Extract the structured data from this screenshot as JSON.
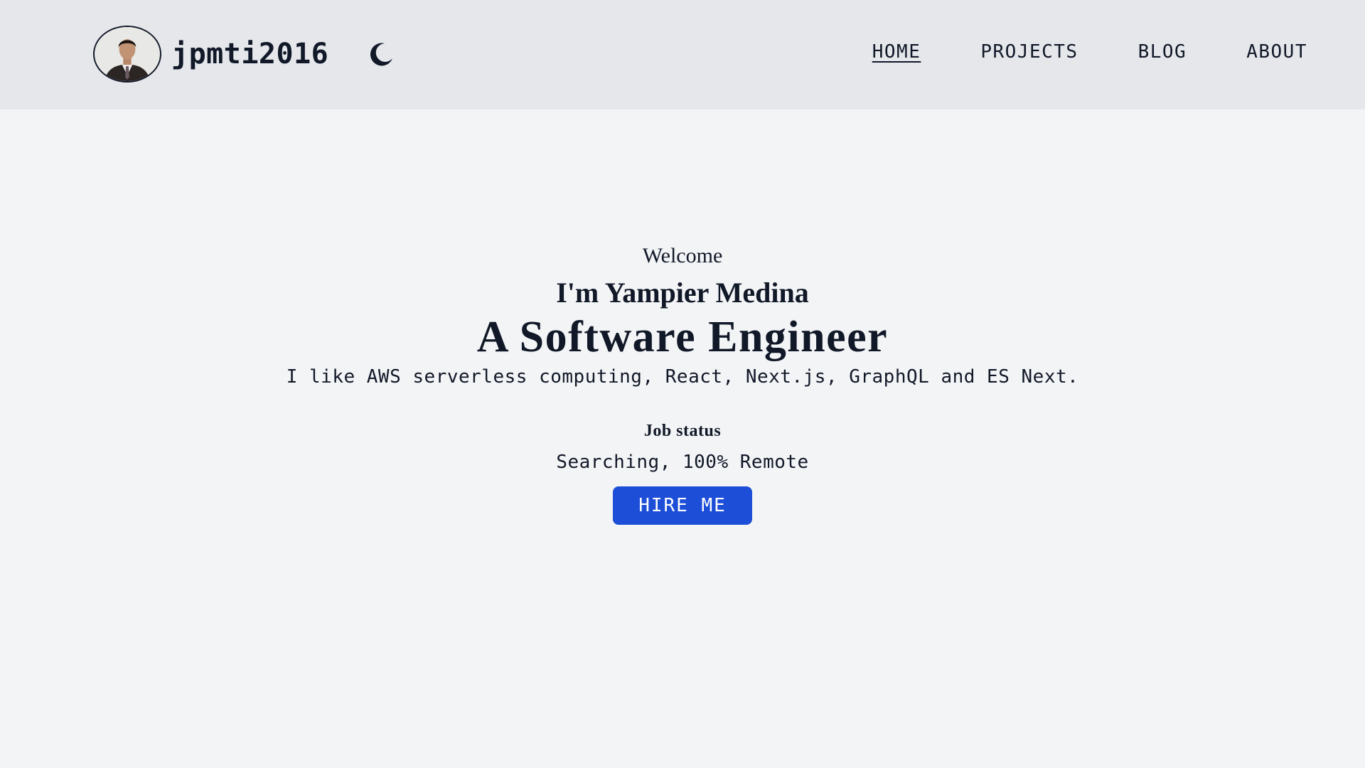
{
  "header": {
    "site_name": "jpmti2016",
    "avatar_icon": "avatar-photo",
    "theme_toggle_icon": "moon-icon",
    "nav": [
      {
        "label": "HOME",
        "active": true
      },
      {
        "label": "PROJECTS",
        "active": false
      },
      {
        "label": "BLOG",
        "active": false
      },
      {
        "label": "ABOUT",
        "active": false
      }
    ]
  },
  "hero": {
    "welcome": "Welcome",
    "intro": "I'm Yampier Medina",
    "role": "A Software Engineer",
    "tagline": "I like AWS serverless computing, React, Next.js, GraphQL and ES Next.",
    "job_status_heading": "Job status",
    "job_status_value": "Searching, 100% Remote",
    "cta_label": "HIRE ME"
  },
  "colors": {
    "header_bg": "#e5e7eb",
    "page_bg": "#f3f4f6",
    "text": "#111827",
    "button_bg": "#1d4ed8",
    "button_text": "#ffffff"
  }
}
